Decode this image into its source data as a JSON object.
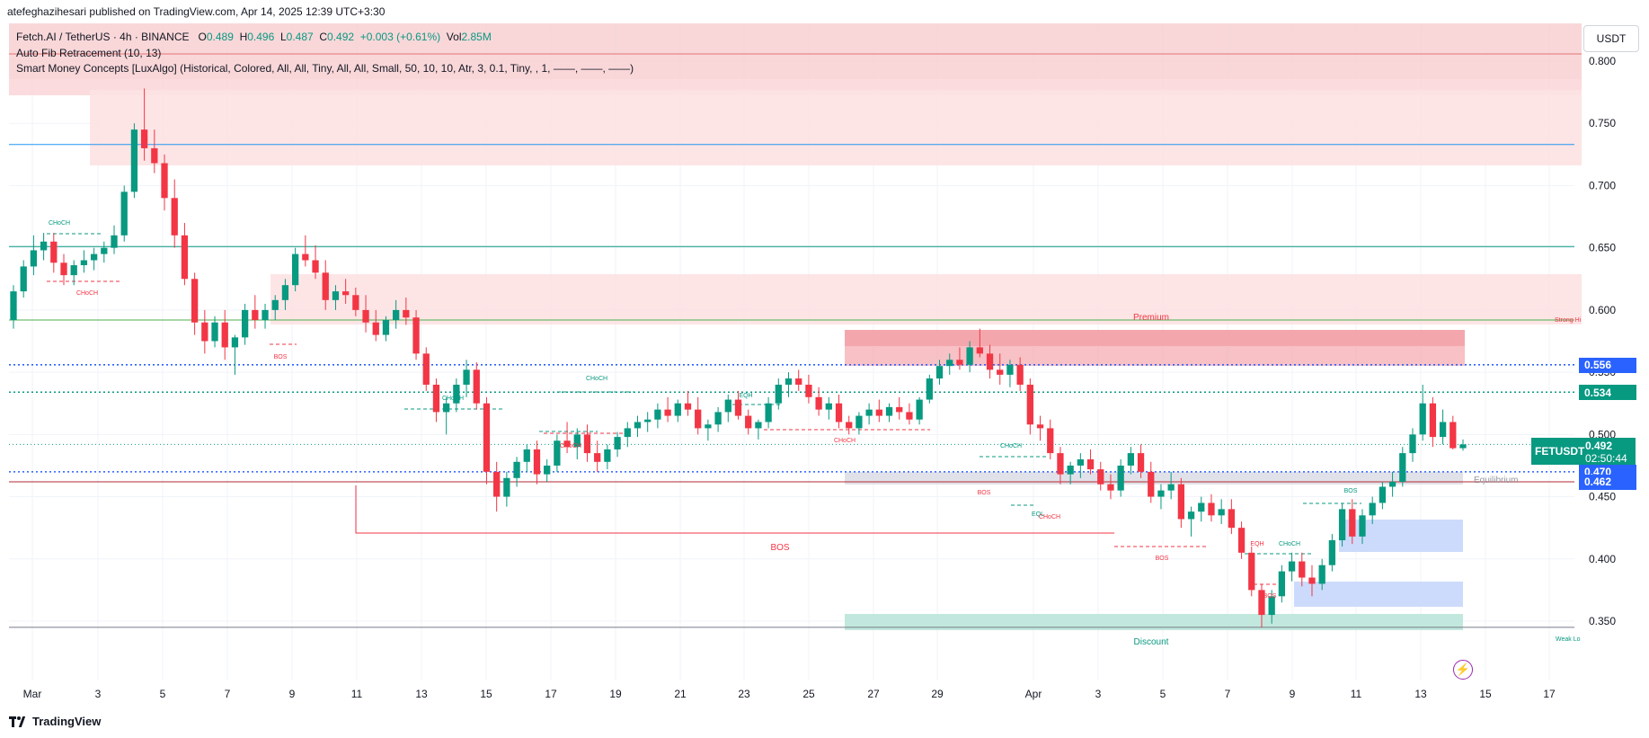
{
  "header": {
    "publisher": "atefeghazihesari published on TradingView.com, Apr 14, 2025 12:39 UTC+3:30"
  },
  "legend": {
    "symbol": "Fetch.AI / TetherUS · 4h · BINANCE",
    "o_label": "O",
    "o": "0.489",
    "h_label": "H",
    "h": "0.496",
    "l_label": "L",
    "l": "0.487",
    "c_label": "C",
    "c": "0.492",
    "change": "+0.003 (+0.61%)",
    "vol_label": "Vol",
    "vol": "2.85M",
    "indicator1": "Auto Fib Retracement (10, 13)",
    "indicator2": "Smart Money Concepts [LuxAlgo] (Historical, Colored, All, All, Tiny, All, All, Small, 50, 10, 10, Atr, 3, 0.1, Tiny, , 1, ——, ——, ——)"
  },
  "price_scale": {
    "unit": "USDT",
    "symbol_tag": "FETUSDT",
    "last_price": "0.492",
    "countdown": "02:50:44",
    "tags": [
      {
        "label": "0.556",
        "value": 0.556,
        "color": "#2962ff"
      },
      {
        "label": "0.534",
        "value": 0.534,
        "color": "#089981"
      },
      {
        "label": "0.470",
        "value": 0.47,
        "color": "#2962ff"
      },
      {
        "label": "0.462",
        "value": 0.462,
        "color": "#2962ff"
      }
    ]
  },
  "footer": {
    "brand": "TradingView"
  },
  "colors": {
    "up": "#089981",
    "down": "#f23645",
    "fib_blue": "#2962ff"
  },
  "chart_data": {
    "type": "candlestick",
    "title": "Fetch.AI / TetherUS · 4h · BINANCE",
    "ylim": [
      0.305,
      0.82
    ],
    "y_ticks": [
      0.35,
      0.4,
      0.45,
      0.5,
      0.55,
      0.6,
      0.65,
      0.7,
      0.75,
      0.8
    ],
    "x_ticks": [
      "Mar",
      "3",
      "5",
      "7",
      "9",
      "11",
      "13",
      "15",
      "17",
      "19",
      "21",
      "23",
      "25",
      "27",
      "29",
      "Apr",
      "3",
      "5",
      "7",
      "9",
      "11",
      "13",
      "15",
      "17"
    ],
    "grid": true,
    "levels": [
      {
        "value": 0.651,
        "color": "#089981"
      },
      {
        "value": 0.592,
        "color": "#4caf50"
      },
      {
        "value": 0.733,
        "color": "#2196f3"
      },
      {
        "value": 0.556,
        "color": "#2962ff",
        "dotted": true
      },
      {
        "value": 0.534,
        "color": "#089981",
        "dotted": true
      },
      {
        "value": 0.47,
        "color": "#2962ff",
        "dotted": true
      },
      {
        "value": 0.462,
        "color": "#b22833"
      },
      {
        "value": 0.345,
        "color": "#787b86"
      }
    ],
    "labels": {
      "premium": "Premium",
      "discount": "Discount",
      "equilibrium": "Equilibrium",
      "strong_high": "Strong Hi",
      "weak_low": "Weak Lo",
      "bos": "BOS",
      "choch": "CHoCH",
      "eqh": "EQH",
      "eql": "EQL"
    },
    "candles": [
      [
        0.592,
        0.62,
        0.585,
        0.615
      ],
      [
        0.615,
        0.64,
        0.61,
        0.635
      ],
      [
        0.635,
        0.66,
        0.628,
        0.648
      ],
      [
        0.648,
        0.662,
        0.64,
        0.655
      ],
      [
        0.655,
        0.662,
        0.63,
        0.638
      ],
      [
        0.638,
        0.645,
        0.62,
        0.628
      ],
      [
        0.628,
        0.64,
        0.62,
        0.636
      ],
      [
        0.636,
        0.648,
        0.63,
        0.64
      ],
      [
        0.64,
        0.65,
        0.632,
        0.645
      ],
      [
        0.645,
        0.655,
        0.638,
        0.65
      ],
      [
        0.65,
        0.668,
        0.645,
        0.66
      ],
      [
        0.66,
        0.7,
        0.655,
        0.695
      ],
      [
        0.695,
        0.75,
        0.69,
        0.745
      ],
      [
        0.745,
        0.778,
        0.72,
        0.73
      ],
      [
        0.73,
        0.745,
        0.71,
        0.718
      ],
      [
        0.718,
        0.725,
        0.68,
        0.69
      ],
      [
        0.69,
        0.705,
        0.65,
        0.66
      ],
      [
        0.66,
        0.67,
        0.62,
        0.625
      ],
      [
        0.625,
        0.63,
        0.58,
        0.59
      ],
      [
        0.59,
        0.6,
        0.565,
        0.575
      ],
      [
        0.575,
        0.595,
        0.57,
        0.59
      ],
      [
        0.59,
        0.6,
        0.56,
        0.57
      ],
      [
        0.57,
        0.58,
        0.548,
        0.578
      ],
      [
        0.578,
        0.605,
        0.572,
        0.6
      ],
      [
        0.6,
        0.612,
        0.585,
        0.592
      ],
      [
        0.592,
        0.605,
        0.585,
        0.6
      ],
      [
        0.6,
        0.612,
        0.592,
        0.608
      ],
      [
        0.608,
        0.625,
        0.6,
        0.62
      ],
      [
        0.62,
        0.65,
        0.615,
        0.645
      ],
      [
        0.645,
        0.66,
        0.635,
        0.64
      ],
      [
        0.64,
        0.652,
        0.625,
        0.63
      ],
      [
        0.63,
        0.64,
        0.6,
        0.608
      ],
      [
        0.608,
        0.62,
        0.6,
        0.615
      ],
      [
        0.615,
        0.625,
        0.605,
        0.612
      ],
      [
        0.612,
        0.618,
        0.595,
        0.6
      ],
      [
        0.6,
        0.612,
        0.582,
        0.59
      ],
      [
        0.59,
        0.6,
        0.575,
        0.58
      ],
      [
        0.58,
        0.595,
        0.575,
        0.592
      ],
      [
        0.592,
        0.608,
        0.585,
        0.6
      ],
      [
        0.6,
        0.61,
        0.588,
        0.594
      ],
      [
        0.594,
        0.6,
        0.56,
        0.565
      ],
      [
        0.565,
        0.57,
        0.535,
        0.54
      ],
      [
        0.54,
        0.545,
        0.51,
        0.518
      ],
      [
        0.518,
        0.53,
        0.5,
        0.525
      ],
      [
        0.525,
        0.545,
        0.518,
        0.54
      ],
      [
        0.54,
        0.56,
        0.53,
        0.552
      ],
      [
        0.552,
        0.558,
        0.52,
        0.525
      ],
      [
        0.525,
        0.53,
        0.46,
        0.47
      ],
      [
        0.47,
        0.478,
        0.438,
        0.45
      ],
      [
        0.45,
        0.47,
        0.442,
        0.465
      ],
      [
        0.465,
        0.482,
        0.458,
        0.478
      ],
      [
        0.478,
        0.492,
        0.47,
        0.488
      ],
      [
        0.488,
        0.495,
        0.46,
        0.468
      ],
      [
        0.468,
        0.48,
        0.462,
        0.475
      ],
      [
        0.475,
        0.5,
        0.47,
        0.495
      ],
      [
        0.495,
        0.51,
        0.485,
        0.49
      ],
      [
        0.49,
        0.505,
        0.48,
        0.5
      ],
      [
        0.5,
        0.508,
        0.478,
        0.485
      ],
      [
        0.485,
        0.495,
        0.47,
        0.478
      ],
      [
        0.478,
        0.492,
        0.472,
        0.488
      ],
      [
        0.488,
        0.502,
        0.482,
        0.498
      ],
      [
        0.498,
        0.51,
        0.49,
        0.505
      ],
      [
        0.505,
        0.515,
        0.498,
        0.51
      ],
      [
        0.51,
        0.518,
        0.502,
        0.512
      ],
      [
        0.512,
        0.525,
        0.505,
        0.52
      ],
      [
        0.52,
        0.53,
        0.51,
        0.515
      ],
      [
        0.515,
        0.528,
        0.51,
        0.525
      ],
      [
        0.525,
        0.535,
        0.515,
        0.52
      ],
      [
        0.52,
        0.53,
        0.5,
        0.505
      ],
      [
        0.505,
        0.512,
        0.495,
        0.508
      ],
      [
        0.508,
        0.522,
        0.502,
        0.518
      ],
      [
        0.518,
        0.532,
        0.51,
        0.528
      ],
      [
        0.528,
        0.535,
        0.512,
        0.515
      ],
      [
        0.515,
        0.52,
        0.5,
        0.505
      ],
      [
        0.505,
        0.512,
        0.496,
        0.51
      ],
      [
        0.51,
        0.53,
        0.505,
        0.525
      ],
      [
        0.525,
        0.545,
        0.52,
        0.54
      ],
      [
        0.54,
        0.55,
        0.53,
        0.545
      ],
      [
        0.545,
        0.552,
        0.535,
        0.54
      ],
      [
        0.54,
        0.548,
        0.525,
        0.53
      ],
      [
        0.53,
        0.538,
        0.515,
        0.52
      ],
      [
        0.52,
        0.53,
        0.512,
        0.525
      ],
      [
        0.525,
        0.532,
        0.505,
        0.51
      ],
      [
        0.51,
        0.515,
        0.5,
        0.505
      ],
      [
        0.505,
        0.518,
        0.5,
        0.515
      ],
      [
        0.515,
        0.525,
        0.508,
        0.52
      ],
      [
        0.52,
        0.528,
        0.51,
        0.515
      ],
      [
        0.515,
        0.525,
        0.51,
        0.522
      ],
      [
        0.522,
        0.53,
        0.512,
        0.518
      ],
      [
        0.518,
        0.525,
        0.508,
        0.512
      ],
      [
        0.512,
        0.53,
        0.508,
        0.528
      ],
      [
        0.528,
        0.548,
        0.525,
        0.545
      ],
      [
        0.545,
        0.56,
        0.54,
        0.555
      ],
      [
        0.555,
        0.565,
        0.548,
        0.56
      ],
      [
        0.56,
        0.57,
        0.552,
        0.556
      ],
      [
        0.556,
        0.575,
        0.55,
        0.57
      ],
      [
        0.57,
        0.585,
        0.562,
        0.565
      ],
      [
        0.565,
        0.572,
        0.545,
        0.552
      ],
      [
        0.552,
        0.565,
        0.54,
        0.548
      ],
      [
        0.548,
        0.56,
        0.538,
        0.556
      ],
      [
        0.556,
        0.562,
        0.535,
        0.54
      ],
      [
        0.54,
        0.545,
        0.5,
        0.508
      ],
      [
        0.508,
        0.515,
        0.495,
        0.505
      ],
      [
        0.505,
        0.512,
        0.48,
        0.485
      ],
      [
        0.485,
        0.49,
        0.46,
        0.468
      ],
      [
        0.468,
        0.478,
        0.46,
        0.475
      ],
      [
        0.475,
        0.485,
        0.465,
        0.48
      ],
      [
        0.48,
        0.488,
        0.468,
        0.472
      ],
      [
        0.472,
        0.478,
        0.455,
        0.46
      ],
      [
        0.46,
        0.468,
        0.448,
        0.455
      ],
      [
        0.455,
        0.48,
        0.45,
        0.475
      ],
      [
        0.475,
        0.49,
        0.468,
        0.485
      ],
      [
        0.485,
        0.492,
        0.465,
        0.47
      ],
      [
        0.47,
        0.478,
        0.445,
        0.45
      ],
      [
        0.45,
        0.46,
        0.44,
        0.455
      ],
      [
        0.455,
        0.47,
        0.448,
        0.46
      ],
      [
        0.46,
        0.465,
        0.425,
        0.432
      ],
      [
        0.432,
        0.442,
        0.418,
        0.438
      ],
      [
        0.438,
        0.45,
        0.43,
        0.445
      ],
      [
        0.445,
        0.452,
        0.43,
        0.435
      ],
      [
        0.435,
        0.448,
        0.428,
        0.44
      ],
      [
        0.44,
        0.448,
        0.42,
        0.425
      ],
      [
        0.425,
        0.43,
        0.4,
        0.405
      ],
      [
        0.405,
        0.41,
        0.37,
        0.375
      ],
      [
        0.375,
        0.38,
        0.345,
        0.355
      ],
      [
        0.355,
        0.375,
        0.348,
        0.37
      ],
      [
        0.37,
        0.395,
        0.365,
        0.39
      ],
      [
        0.39,
        0.405,
        0.382,
        0.398
      ],
      [
        0.398,
        0.405,
        0.378,
        0.385
      ],
      [
        0.385,
        0.395,
        0.37,
        0.38
      ],
      [
        0.38,
        0.4,
        0.375,
        0.395
      ],
      [
        0.395,
        0.42,
        0.39,
        0.415
      ],
      [
        0.415,
        0.445,
        0.41,
        0.44
      ],
      [
        0.44,
        0.448,
        0.412,
        0.418
      ],
      [
        0.418,
        0.44,
        0.412,
        0.435
      ],
      [
        0.435,
        0.45,
        0.428,
        0.445
      ],
      [
        0.445,
        0.462,
        0.44,
        0.458
      ],
      [
        0.458,
        0.47,
        0.45,
        0.462
      ],
      [
        0.462,
        0.49,
        0.458,
        0.485
      ],
      [
        0.485,
        0.505,
        0.478,
        0.5
      ],
      [
        0.5,
        0.54,
        0.495,
        0.525
      ],
      [
        0.525,
        0.53,
        0.49,
        0.498
      ],
      [
        0.498,
        0.52,
        0.492,
        0.51
      ],
      [
        0.51,
        0.515,
        0.488,
        0.489
      ],
      [
        0.489,
        0.496,
        0.487,
        0.492
      ]
    ]
  }
}
